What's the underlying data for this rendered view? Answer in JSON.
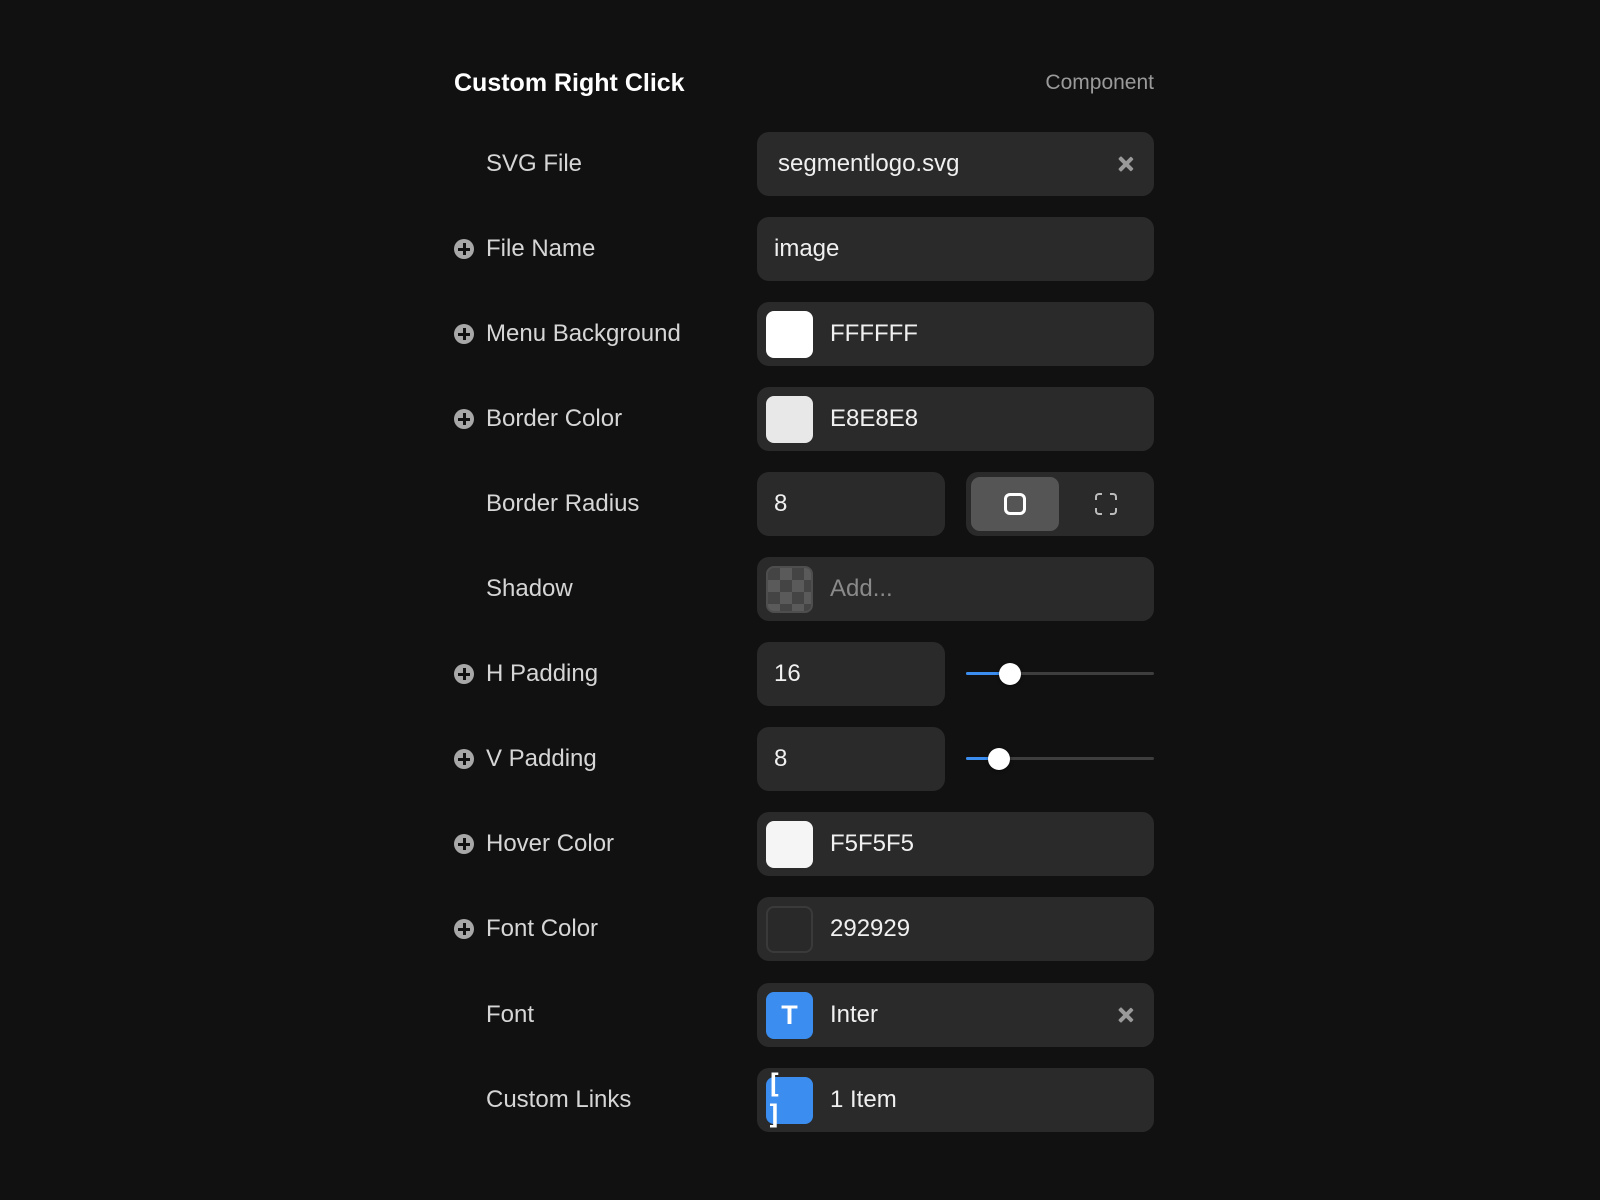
{
  "header": {
    "title": "Custom Right Click",
    "type_label": "Component"
  },
  "properties": {
    "svg_file": {
      "label": "SVG File",
      "value": "segmentlogo.svg"
    },
    "file_name": {
      "label": "File Name",
      "value": "image"
    },
    "menu_background": {
      "label": "Menu Background",
      "value": "FFFFFF",
      "color": "#FFFFFF"
    },
    "border_color": {
      "label": "Border Color",
      "value": "E8E8E8",
      "color": "#E8E8E8"
    },
    "border_radius": {
      "label": "Border Radius",
      "value": "8",
      "mode": "all-corners"
    },
    "shadow": {
      "label": "Shadow",
      "placeholder": "Add..."
    },
    "h_padding": {
      "label": "H Padding",
      "value": "16",
      "slider_fraction": 0.2
    },
    "v_padding": {
      "label": "V Padding",
      "value": "8",
      "slider_fraction": 0.13
    },
    "hover_color": {
      "label": "Hover Color",
      "value": "F5F5F5",
      "color": "#F5F5F5"
    },
    "font_color": {
      "label": "Font Color",
      "value": "292929",
      "color": "#292929"
    },
    "font": {
      "label": "Font",
      "value": "Inter",
      "icon": "font-T-icon",
      "icon_glyph": "T"
    },
    "custom_links": {
      "label": "Custom Links",
      "value": "1 Item",
      "icon": "array-brackets-icon",
      "icon_glyph": "[ ]"
    }
  },
  "colors": {
    "accent": "#3B8EEF",
    "background": "#111111",
    "field": "#2A2A2A"
  }
}
